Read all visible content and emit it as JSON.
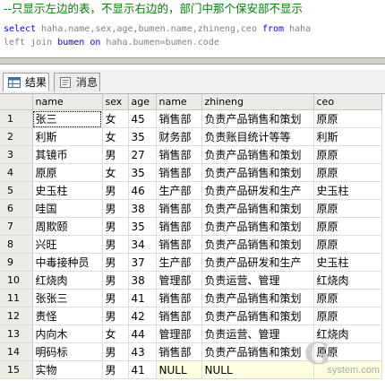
{
  "editor": {
    "comment": "--只显示左边的表，不显示右边的，部门中那个保安部不显示",
    "line2": {
      "select": "select",
      "columns": " haha.name,sex,age,bumen.name,zhineng,ceo ",
      "from": "from",
      "table": " haha"
    },
    "line3": {
      "prefix": "left join ",
      "bumen": "bumen",
      "on": " on ",
      "cond": "haha.bumen=bumen.code"
    }
  },
  "tabs": [
    {
      "label": "结果",
      "icon": "grid-results-icon"
    },
    {
      "label": "消息",
      "icon": "messages-icon"
    }
  ],
  "grid": {
    "columns": [
      "name",
      "sex",
      "age",
      "name",
      "zhineng",
      "ceo"
    ],
    "rows": [
      [
        "1",
        "张三",
        "女",
        "45",
        "销售部",
        "负责产品销售和策划",
        "原原"
      ],
      [
        "2",
        "利斯",
        "女",
        "35",
        "财务部",
        "负责账目统计等等",
        "利斯"
      ],
      [
        "3",
        "其镜币",
        "男",
        "27",
        "销售部",
        "负责产品销售和策划",
        "原原"
      ],
      [
        "4",
        "原原",
        "女",
        "35",
        "销售部",
        "负责产品销售和策划",
        "原原"
      ],
      [
        "5",
        "史玉柱",
        "男",
        "46",
        "生产部",
        "负责产品研发和生产",
        "史玉柱"
      ],
      [
        "6",
        "哇国",
        "男",
        "38",
        "销售部",
        "负责产品销售和策划",
        "原原"
      ],
      [
        "7",
        "周欺颐",
        "男",
        "35",
        "销售部",
        "负责产品销售和策划",
        "原原"
      ],
      [
        "8",
        "兴旺",
        "男",
        "34",
        "销售部",
        "负责产品销售和策划",
        "原原"
      ],
      [
        "9",
        "中毒接种员",
        "男",
        "37",
        "生产部",
        "负责产品研发和生产",
        "史玉柱"
      ],
      [
        "10",
        "红烧肉",
        "男",
        "38",
        "管理部",
        "负责运营、管理",
        "红烧肉"
      ],
      [
        "11",
        "张张三",
        "男",
        "41",
        "销售部",
        "负责产品销售和策划",
        "原原"
      ],
      [
        "12",
        "责怪",
        "男",
        "42",
        "销售部",
        "负责产品销售和策划",
        "原原"
      ],
      [
        "13",
        "内向木",
        "女",
        "44",
        "管理部",
        "负责运营、管理",
        "红烧肉"
      ],
      [
        "14",
        "明码标",
        "男",
        "43",
        "销售部",
        "负责产品销售和策划",
        "原原"
      ],
      [
        "15",
        "实物",
        "男",
        "41",
        "NULL",
        "NULL",
        ""
      ]
    ]
  },
  "watermark": {
    "logo": "G",
    "site": "system.com"
  }
}
